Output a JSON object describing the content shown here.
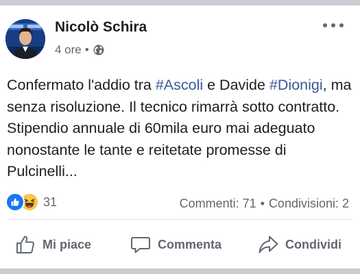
{
  "post": {
    "author": "Nicolò Schira",
    "time": "4 ore",
    "separator": "•",
    "privacy_icon": "globe-icon",
    "avatar_icon": "avatar-photo",
    "text": {
      "part1": "Confermato l'addio tra ",
      "tag1": "#Ascoli",
      "part2": " e Davide ",
      "tag2": "#Dionigi",
      "part3": ", ma senza risoluzione. Il tecnico rimarrà sotto contratto. Stipendio annuale di 60mila euro mai adeguato nonostante le tante e reitetate promesse di Pulcinelli..."
    }
  },
  "stats": {
    "reaction_icons": [
      "like-reaction-icon",
      "haha-reaction-icon"
    ],
    "reactions_count": "31",
    "comments": "Commenti: 71",
    "separator": "•",
    "shares": "Condivisioni: 2"
  },
  "actions": {
    "like": "Mi piace",
    "comment": "Commenta",
    "share": "Condividi"
  },
  "colors": {
    "link": "#385898",
    "like_blue": "#1877f2",
    "haha_yellow": "#f7c84a",
    "secondary_text": "#65676b",
    "background": "#c9ccd1"
  }
}
